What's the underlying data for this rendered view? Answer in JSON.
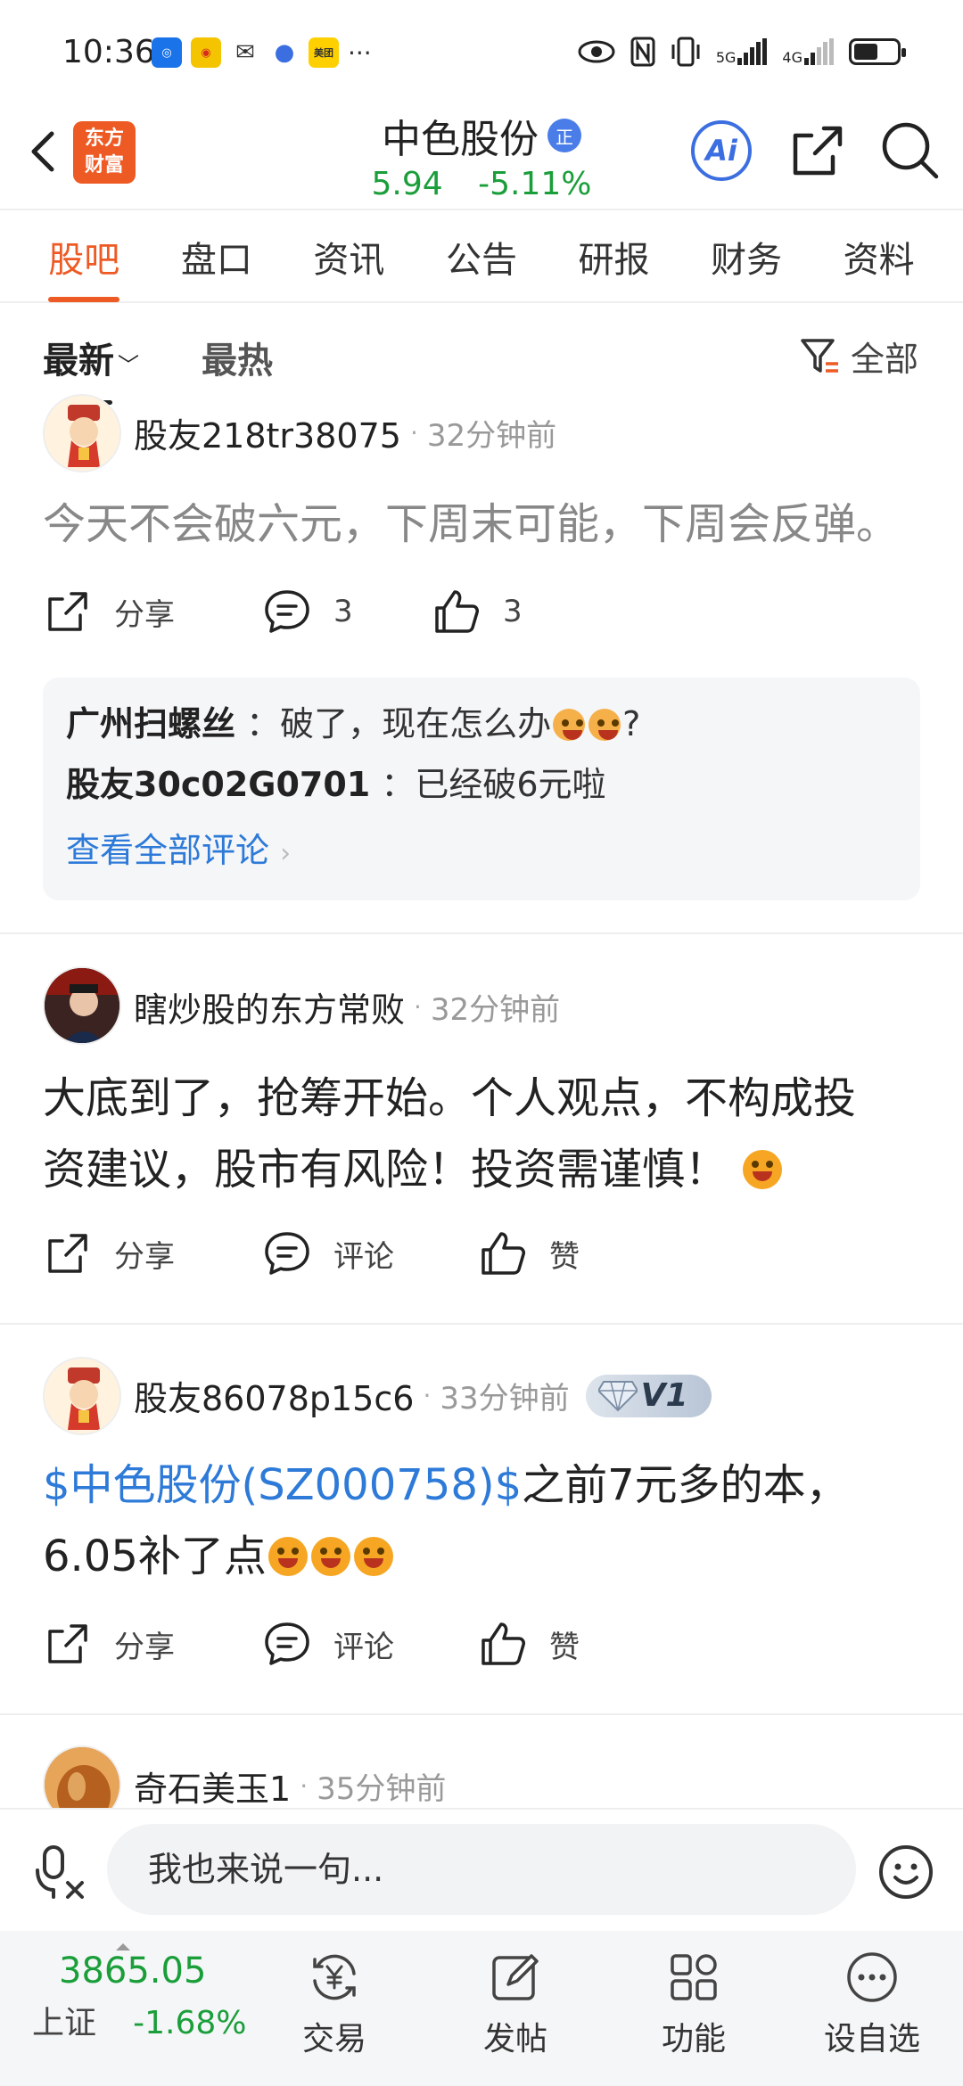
{
  "status_bar": {
    "time": "10:36",
    "more": "···",
    "net1": "5G",
    "net2": "4G"
  },
  "header": {
    "brand": "东方财富",
    "stock_name": "中色股份",
    "badge": "正",
    "price": "5.94",
    "change": "-5.11%",
    "ai_label": "Ai"
  },
  "tabs": [
    "股吧",
    "盘口",
    "资讯",
    "公告",
    "研报",
    "财务",
    "资料"
  ],
  "filter": {
    "latest": "最新",
    "hot": "最热",
    "all": "全部"
  },
  "posts": [
    {
      "author": "股友218tr38075",
      "time": "32分钟前",
      "body": "今天不会破六元，下周末可能，下周会反弹。",
      "share": "分享",
      "comments": "3",
      "likes": "3",
      "replies": [
        {
          "user": "广州扫螺丝",
          "text": "：破了，现在怎么办",
          "suffix": "?"
        },
        {
          "user": "股友30c02G0701",
          "text": "：已经破6元啦"
        }
      ],
      "view_all": "查看全部评论"
    },
    {
      "author": "瞎炒股的东方常败",
      "time": "32分钟前",
      "body_line1": "大底到了，抢筹开始。个人观点，不构成投",
      "body_line2": "资建议，股市有风险！投资需谨慎！",
      "share": "分享",
      "comment": "评论",
      "like": "赞"
    },
    {
      "author": "股友86078p15c6",
      "time": "33分钟前",
      "vip": "V1",
      "stock_link": "$中色股份(SZ000758)$",
      "body_line1_rest": "之前7元多的本，",
      "body_line2": "6.05补了点",
      "share": "分享",
      "comment": "评论",
      "like": "赞"
    },
    {
      "author": "奇石美玉1",
      "time": "35分钟前"
    }
  ],
  "input": {
    "placeholder": "我也来说一句..."
  },
  "bottom_nav": {
    "index_value": "3865.05",
    "index_name": "上证",
    "index_change": "-1.68%",
    "items": [
      "交易",
      "发帖",
      "功能",
      "设自选"
    ]
  },
  "colors": {
    "accent": "#ee5a24",
    "down": "#1a9e3a",
    "link": "#2d7ad8"
  }
}
